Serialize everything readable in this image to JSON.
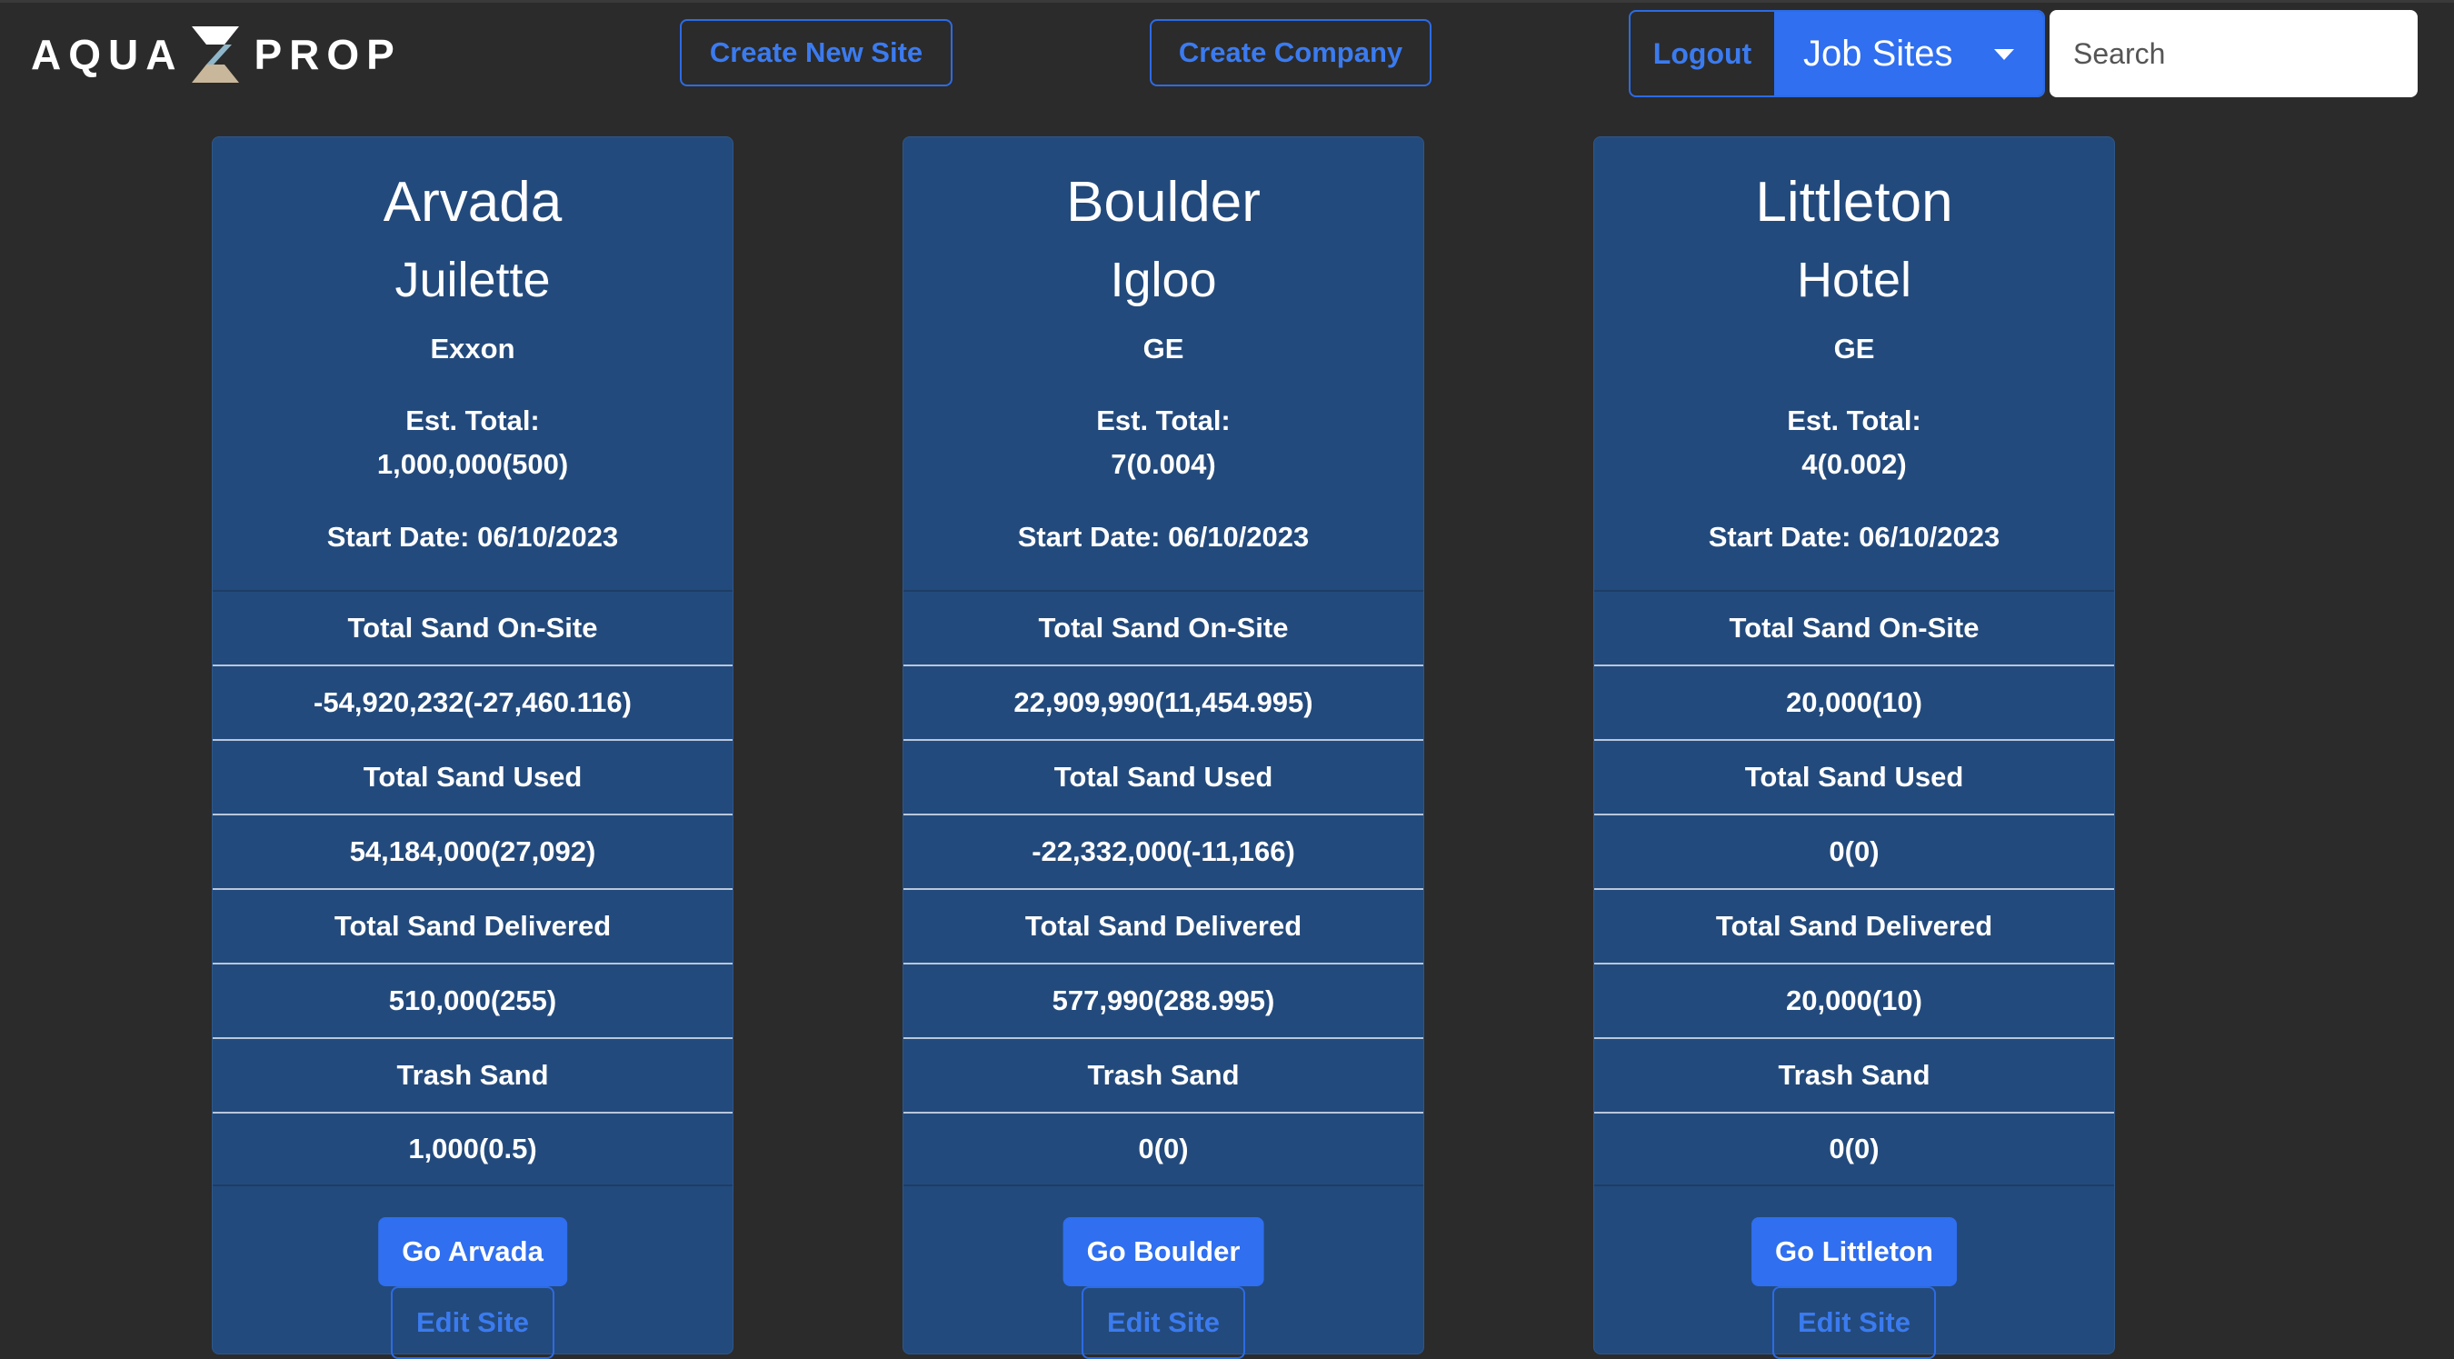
{
  "header": {
    "logo_left": "AQUA",
    "logo_right": "PROP",
    "create_site_label": "Create New Site",
    "create_company_label": "Create Company",
    "logout_label": "Logout",
    "jobsites_label": "Job Sites",
    "search_placeholder": "Search"
  },
  "colors": {
    "background": "#2b2b2b",
    "card": "#234a7c",
    "accent": "#2f6ff0"
  },
  "sites": [
    {
      "city": "Arvada",
      "site": "Juilette",
      "company": "Exxon",
      "est_label": "Est. Total:",
      "est_value": "1,000,000(500)",
      "start_date": "Start Date: 06/10/2023",
      "rows": [
        "Total Sand On-Site",
        "-54,920,232(-27,460.116)",
        "Total Sand Used",
        "54,184,000(27,092)",
        "Total Sand Delivered",
        "510,000(255)",
        "Trash Sand",
        "1,000(0.5)"
      ],
      "go_label": "Go Arvada",
      "edit_label": "Edit Site"
    },
    {
      "city": "Boulder",
      "site": "Igloo",
      "company": "GE",
      "est_label": "Est. Total:",
      "est_value": "7(0.004)",
      "start_date": "Start Date: 06/10/2023",
      "rows": [
        "Total Sand On-Site",
        "22,909,990(11,454.995)",
        "Total Sand Used",
        "-22,332,000(-11,166)",
        "Total Sand Delivered",
        "577,990(288.995)",
        "Trash Sand",
        "0(0)"
      ],
      "go_label": "Go Boulder",
      "edit_label": "Edit Site"
    },
    {
      "city": "Littleton",
      "site": "Hotel",
      "company": "GE",
      "est_label": "Est. Total:",
      "est_value": "4(0.002)",
      "start_date": "Start Date: 06/10/2023",
      "rows": [
        "Total Sand On-Site",
        "20,000(10)",
        "Total Sand Used",
        "0(0)",
        "Total Sand Delivered",
        "20,000(10)",
        "Trash Sand",
        "0(0)"
      ],
      "go_label": "Go Littleton",
      "edit_label": "Edit Site"
    }
  ]
}
